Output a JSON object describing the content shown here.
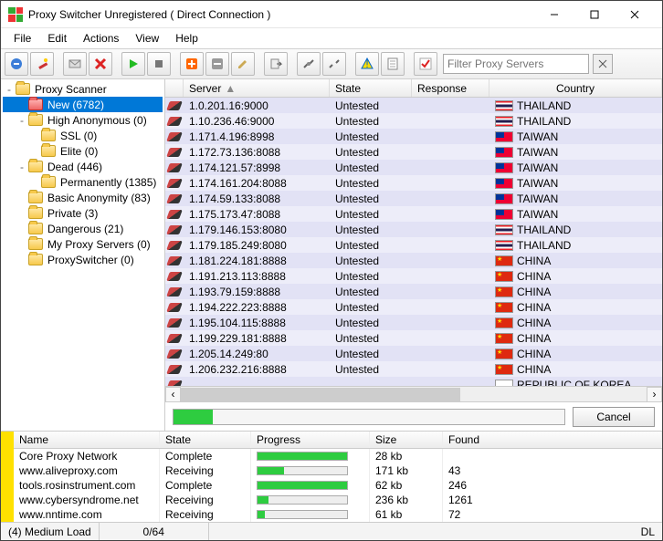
{
  "window": {
    "title": "Proxy Switcher Unregistered ( Direct Connection )"
  },
  "menu": [
    "File",
    "Edit",
    "Actions",
    "View",
    "Help"
  ],
  "filter": {
    "placeholder": "Filter Proxy Servers"
  },
  "tree": {
    "root": "Proxy Scanner",
    "nodes": [
      {
        "label": "New (6782)",
        "indent": 1,
        "folder": "red",
        "selected": true
      },
      {
        "label": "High Anonymous (0)",
        "indent": 1,
        "expander": "-"
      },
      {
        "label": "SSL (0)",
        "indent": 2
      },
      {
        "label": "Elite (0)",
        "indent": 2
      },
      {
        "label": "Dead (446)",
        "indent": 1,
        "expander": "-"
      },
      {
        "label": "Permanently (1385)",
        "indent": 2
      },
      {
        "label": "Basic Anonymity (83)",
        "indent": 1
      },
      {
        "label": "Private (3)",
        "indent": 1
      },
      {
        "label": "Dangerous (21)",
        "indent": 1
      },
      {
        "label": "My Proxy Servers (0)",
        "indent": 1
      },
      {
        "label": "ProxySwitcher (0)",
        "indent": 1
      }
    ]
  },
  "columns": {
    "server": "Server",
    "state": "State",
    "response": "Response",
    "country": "Country"
  },
  "rows": [
    {
      "server": "1.0.201.16:9000",
      "state": "Untested",
      "country": "THAILAND",
      "flag": "th"
    },
    {
      "server": "1.10.236.46:9000",
      "state": "Untested",
      "country": "THAILAND",
      "flag": "th"
    },
    {
      "server": "1.171.4.196:8998",
      "state": "Untested",
      "country": "TAIWAN",
      "flag": "tw"
    },
    {
      "server": "1.172.73.136:8088",
      "state": "Untested",
      "country": "TAIWAN",
      "flag": "tw"
    },
    {
      "server": "1.174.121.57:8998",
      "state": "Untested",
      "country": "TAIWAN",
      "flag": "tw"
    },
    {
      "server": "1.174.161.204:8088",
      "state": "Untested",
      "country": "TAIWAN",
      "flag": "tw"
    },
    {
      "server": "1.174.59.133:8088",
      "state": "Untested",
      "country": "TAIWAN",
      "flag": "tw"
    },
    {
      "server": "1.175.173.47:8088",
      "state": "Untested",
      "country": "TAIWAN",
      "flag": "tw"
    },
    {
      "server": "1.179.146.153:8080",
      "state": "Untested",
      "country": "THAILAND",
      "flag": "th"
    },
    {
      "server": "1.179.185.249:8080",
      "state": "Untested",
      "country": "THAILAND",
      "flag": "th"
    },
    {
      "server": "1.181.224.181:8888",
      "state": "Untested",
      "country": "CHINA",
      "flag": "cn"
    },
    {
      "server": "1.191.213.113:8888",
      "state": "Untested",
      "country": "CHINA",
      "flag": "cn"
    },
    {
      "server": "1.193.79.159:8888",
      "state": "Untested",
      "country": "CHINA",
      "flag": "cn"
    },
    {
      "server": "1.194.222.223:8888",
      "state": "Untested",
      "country": "CHINA",
      "flag": "cn"
    },
    {
      "server": "1.195.104.115:8888",
      "state": "Untested",
      "country": "CHINA",
      "flag": "cn"
    },
    {
      "server": "1.199.229.181:8888",
      "state": "Untested",
      "country": "CHINA",
      "flag": "cn"
    },
    {
      "server": "1.205.14.249:80",
      "state": "Untested",
      "country": "CHINA",
      "flag": "cn"
    },
    {
      "server": "1.206.232.216:8888",
      "state": "Untested",
      "country": "CHINA",
      "flag": "cn"
    }
  ],
  "partial_row": {
    "country": "REPUBLIC OF KOREA",
    "flag": "kr"
  },
  "cancel": "Cancel",
  "sources": {
    "columns": {
      "name": "Name",
      "state": "State",
      "progress": "Progress",
      "size": "Size",
      "found": "Found"
    },
    "rows": [
      {
        "name": "Core Proxy Network",
        "state": "Complete",
        "progress": 100,
        "size": "28 kb",
        "found": ""
      },
      {
        "name": "www.aliveproxy.com",
        "state": "Receiving",
        "progress": 30,
        "size": "171 kb",
        "found": "43"
      },
      {
        "name": "tools.rosinstrument.com",
        "state": "Complete",
        "progress": 100,
        "size": "62 kb",
        "found": "246"
      },
      {
        "name": "www.cybersyndrome.net",
        "state": "Receiving",
        "progress": 12,
        "size": "236 kb",
        "found": "1261"
      },
      {
        "name": "www.nntime.com",
        "state": "Receiving",
        "progress": 8,
        "size": "61 kb",
        "found": "72"
      }
    ]
  },
  "status": {
    "load": "(4) Medium Load",
    "count": "0/64",
    "dl": "DL"
  }
}
